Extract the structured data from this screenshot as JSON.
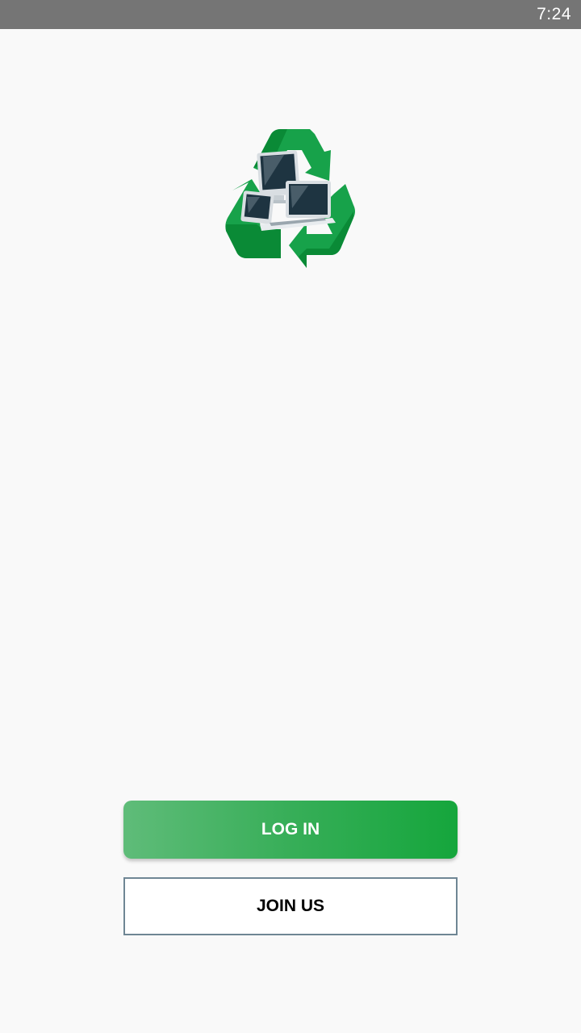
{
  "status_bar": {
    "time": "7:24"
  },
  "logo": {
    "icon": "recycle-devices-icon",
    "colors": {
      "green_dark": "#0a8a36",
      "green": "#17a24a",
      "device_dark": "#1e3441",
      "device_frame": "#d9dee2"
    }
  },
  "actions": {
    "login_label": "LOG IN",
    "join_label": "JOIN US"
  },
  "colors": {
    "status_bar": "#757575",
    "background": "#f9f9f9",
    "login_gradient_start": "#5fbc79",
    "login_gradient_end": "#15a63c",
    "join_border": "#6f8694"
  }
}
